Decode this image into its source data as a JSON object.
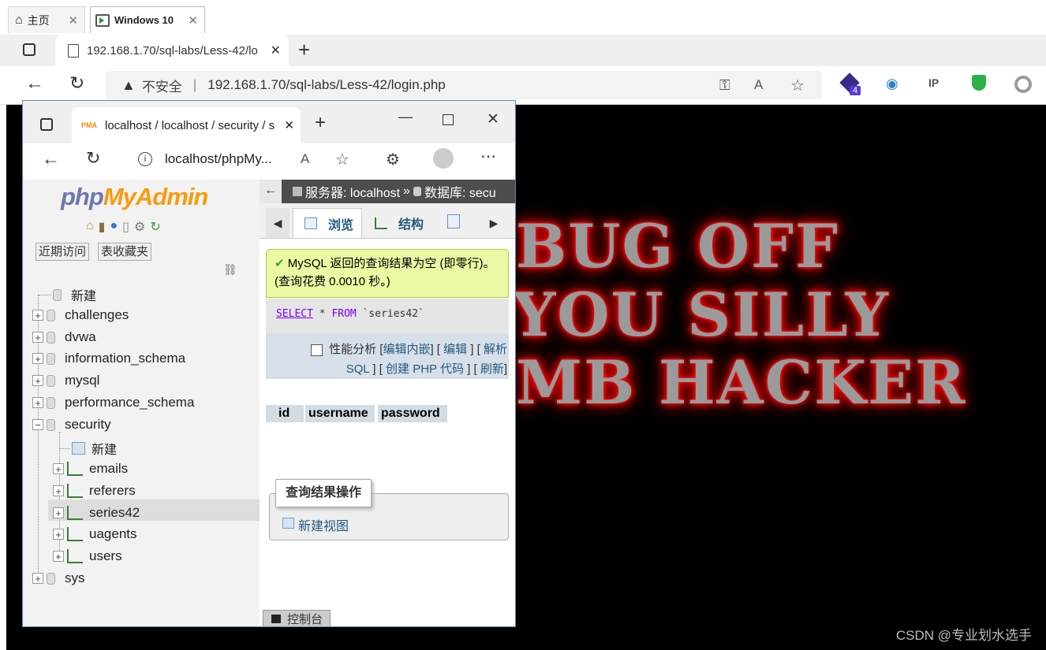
{
  "vm_tabs": {
    "home": "主页",
    "windows": "Windows 10"
  },
  "outer_browser": {
    "tab_title": "192.168.1.70/sql-labs/Less-42/lo",
    "security_label": "不安全",
    "url": "192.168.1.70/sql-labs/Less-42/login.php",
    "ext_badge": "4"
  },
  "page_text": {
    "line1": "BUG OFF",
    "line2": "YOU SILLY",
    "line3": "MB HACKER"
  },
  "watermark": "CSDN @专业划水选手",
  "inner_browser": {
    "tab_title": "localhost / localhost / security / s",
    "url": "localhost/phpMy..."
  },
  "sidebar": {
    "logo_php": "php",
    "logo_myadmin": "MyAdmin",
    "recent_btn": "近期访问",
    "favorites_btn": "表收藏夹",
    "new_label": "新建",
    "databases": [
      "challenges",
      "dvwa",
      "information_schema",
      "mysql",
      "performance_schema",
      "security"
    ],
    "security_new": "新建",
    "tables": [
      "emails",
      "referers",
      "series42",
      "uagents",
      "users"
    ],
    "last_db": "sys"
  },
  "main": {
    "breadcrumb_server": "服务器: localhost",
    "breadcrumb_db": "数据库: secu",
    "tab_browse": "浏览",
    "tab_structure": "结构",
    "message": "MySQL 返回的查询结果为空 (即零行)。 (查询花费 0.0010 秒。)",
    "sql_select": "SELECT",
    "sql_star": "*",
    "sql_from": "FROM",
    "sql_table": "`series42`",
    "profiling": "性能分析",
    "link_edit_inline": "编辑内嵌",
    "link_edit": "编辑",
    "link_explain": "解析",
    "link_sql": "SQL",
    "link_php": "创建 PHP 代码",
    "link_refresh": "刷新",
    "columns": [
      "id",
      "username",
      "password"
    ],
    "ops_legend": "查询结果操作",
    "create_view": "新建视图",
    "console": "控制台"
  }
}
